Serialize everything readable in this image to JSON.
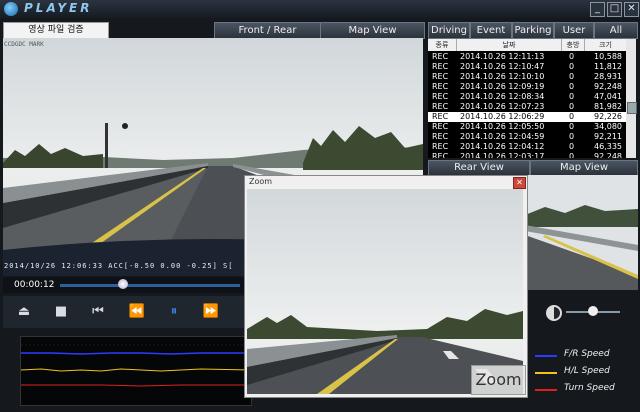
{
  "window": {
    "title": "PLAYER",
    "minimize": "_",
    "restore": "□",
    "close": "✕"
  },
  "left": {
    "verify_button": "영상 파일 검증",
    "front_rear_tab": "Front / Rear",
    "map_view_tab": "Map View",
    "video_tag": "CCDGDC MARK",
    "timestamp": "2014/10/26 12:06:33 ACC[-0.50  0.00  -0.25] S[",
    "elapsed": "00:00:12",
    "seek_fraction": 0.35
  },
  "controls": {
    "eject": "⏏",
    "stop": "■",
    "prev": "⏮",
    "rewind": "⏪",
    "pause": "⏸",
    "forward": "⏩"
  },
  "graph": {
    "legend": [
      {
        "label": "F/R Speed",
        "color": "#2d3bff"
      },
      {
        "label": "H/L Speed",
        "color": "#f0c419"
      },
      {
        "label": "Turn Speed",
        "color": "#e02020"
      }
    ]
  },
  "right": {
    "tabs": [
      "Driving",
      "Event",
      "Parking",
      "User",
      "All"
    ],
    "columns": [
      "종류",
      "날짜",
      "충방",
      "크기"
    ],
    "rows": [
      {
        "type": "REC",
        "date": "2014.10.26 12:11:13",
        "flag": "0",
        "size": "10,588"
      },
      {
        "type": "REC",
        "date": "2014.10.26 12:10:47",
        "flag": "0",
        "size": "11,812"
      },
      {
        "type": "REC",
        "date": "2014.10.26 12:10:10",
        "flag": "0",
        "size": "28,931"
      },
      {
        "type": "REC",
        "date": "2014.10.26 12:09:19",
        "flag": "0",
        "size": "92,248"
      },
      {
        "type": "REC",
        "date": "2014.10.26 12:08:34",
        "flag": "0",
        "size": "47,041"
      },
      {
        "type": "REC",
        "date": "2014.10.26 12:07:23",
        "flag": "0",
        "size": "81,982"
      },
      {
        "type": "REC",
        "date": "2014.10.26 12:06:29",
        "flag": "0",
        "size": "92,226",
        "selected": true
      },
      {
        "type": "REC",
        "date": "2014.10.26 12:05:50",
        "flag": "0",
        "size": "34,080"
      },
      {
        "type": "REC",
        "date": "2014.10.26 12:04:59",
        "flag": "0",
        "size": "92,211"
      },
      {
        "type": "REC",
        "date": "2014.10.26 12:04:12",
        "flag": "0",
        "size": "46,335"
      },
      {
        "type": "REC",
        "date": "2014.10.26 12:03:17",
        "flag": "0",
        "size": "92,248"
      }
    ],
    "rear_view_tab": "Rear View",
    "map_view_tab": "Map View",
    "brightness_fraction": 0.5
  },
  "zoom": {
    "title": "Zoom",
    "close": "✕",
    "label": "Zoom"
  }
}
